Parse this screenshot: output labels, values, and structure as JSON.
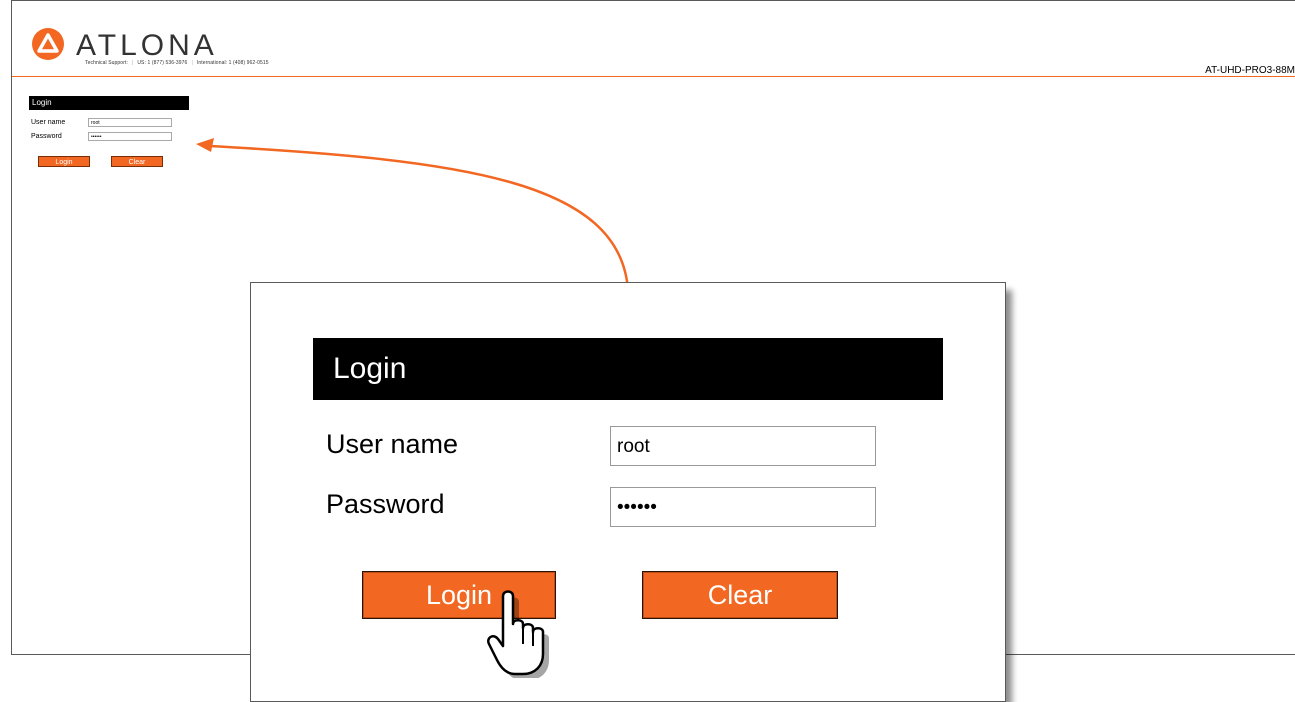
{
  "header": {
    "brand": "ATLONA",
    "support_label": "Technical Support:",
    "support_us": "US: 1 (877) 536-3976",
    "support_intl": "International: 1 (408) 962-0515",
    "model": "AT-UHD-PRO3-88M",
    "accent_color": "#f26722"
  },
  "login": {
    "title": "Login",
    "username_label": "User name",
    "username_value": "root",
    "password_label": "Password",
    "password_value": "••••••",
    "login_button": "Login",
    "clear_button": "Clear"
  },
  "icons": [
    "atlona-logo-icon",
    "hand-pointer-icon",
    "curved-arrow-icon"
  ]
}
